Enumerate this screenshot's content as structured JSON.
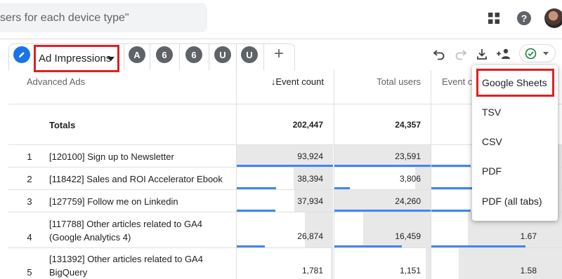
{
  "header": {
    "search_placeholder": "sers for each device type\"",
    "icons": [
      "apps-icon",
      "help-icon"
    ],
    "avatar": "avatar"
  },
  "tabs": {
    "active_label": "Ad Impressions",
    "chips": [
      "A",
      "6",
      "6",
      "U",
      "U"
    ],
    "add_label": "+",
    "toolbar_icons": [
      "undo-icon",
      "redo-icon",
      "download-icon",
      "share-icon",
      "check-circle-icon"
    ]
  },
  "table": {
    "dimension_header": "Advanced Ads",
    "columns": {
      "event_count": "Event count",
      "total_users": "Total users",
      "event_count_per_user": "Event co"
    },
    "sort_arrow": "↓",
    "totals": {
      "label": "Totals",
      "event_count": "202,447",
      "total_users": "24,357"
    },
    "rows": [
      {
        "num": "1",
        "name": "[120100] Sign up to Newsletter",
        "event_count": "93,924",
        "total_users": "23,591",
        "per_user": "",
        "ev_frac": 1.0,
        "tu_frac": 1.0,
        "ec_frac": 0.3
      },
      {
        "num": "2",
        "name": "[118422] Sales and ROI Accelerator Ebook",
        "event_count": "38,394",
        "total_users": "3,806",
        "per_user": "",
        "ev_frac": 0.41,
        "tu_frac": 0.16,
        "ec_frac": 0.55
      },
      {
        "num": "3",
        "name": "[127759] Follow me on Linkedin",
        "event_count": "37,934",
        "total_users": "24,260",
        "per_user": "",
        "ev_frac": 0.4,
        "tu_frac": 1.0,
        "ec_frac": 0.3
      },
      {
        "num": "4",
        "name": "[117788] Other articles related to GA4\n(Google Analytics 4)",
        "event_count": "26,874",
        "total_users": "16,459",
        "per_user": "1.67",
        "ev_frac": 0.29,
        "tu_frac": 0.7,
        "ec_frac": 0.72
      },
      {
        "num": "5",
        "name": "[131392] Other articles related to GA4\nBigQuery",
        "event_count": "1,781",
        "total_users": "1,151",
        "per_user": "1.58",
        "ev_frac": 0.02,
        "tu_frac": 0.05,
        "ec_frac": 0.79
      }
    ]
  },
  "export_menu": {
    "items": [
      "Google Sheets",
      "TSV",
      "CSV",
      "PDF",
      "PDF (all tabs)"
    ]
  }
}
